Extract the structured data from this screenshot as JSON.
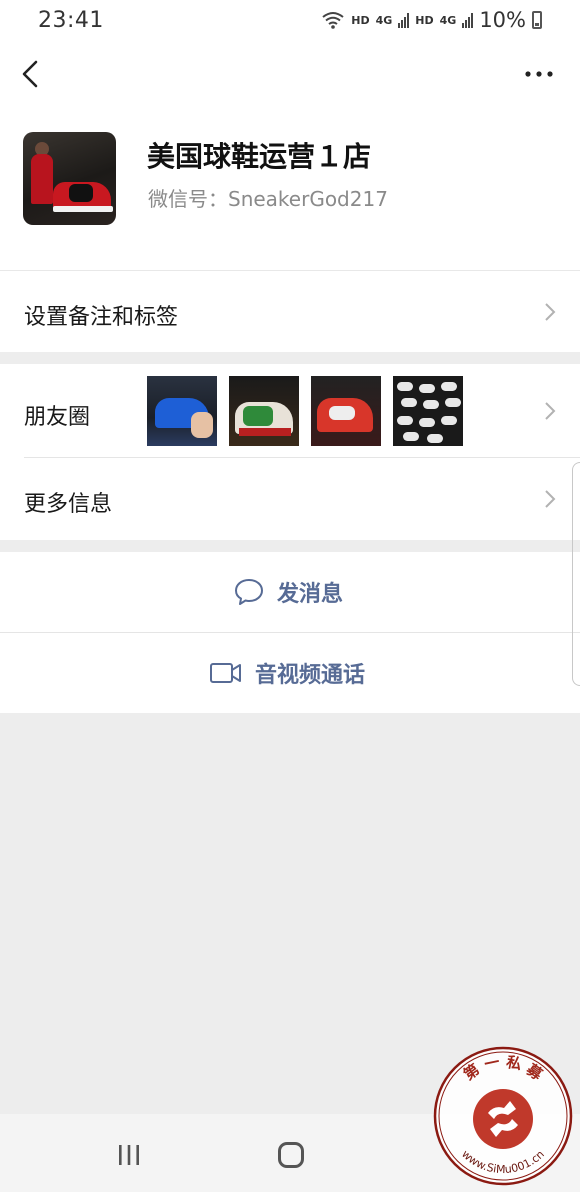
{
  "status_bar": {
    "time": "23:41",
    "hd1": "HD",
    "net1": "4G",
    "hd2": "HD",
    "net2": "4G",
    "battery": "10%"
  },
  "header": {
    "back_icon": "back-arrow-icon",
    "more_icon": "more-dots-icon"
  },
  "profile": {
    "name": "美国球鞋运营１店",
    "wechat_id": "微信号：SneakerGod217"
  },
  "rows": {
    "remark": "设置备注和标签",
    "moments": "朋友圈",
    "more_info": "更多信息"
  },
  "actions": {
    "message": "发消息",
    "video_call": "音视频通话"
  },
  "watermark": {
    "top_text": "第 一 私 募",
    "url_text": "www.SiMu001.cn"
  },
  "colors": {
    "link": "#576b95",
    "background": "#ededed",
    "seal_red": "#c0392b"
  }
}
